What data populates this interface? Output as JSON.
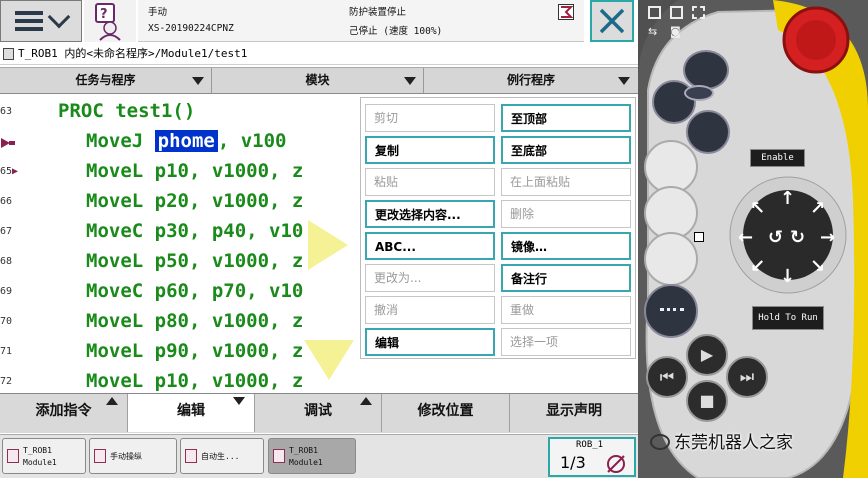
{
  "status": {
    "mode": "手动",
    "controller_name": "XS-20190224CPNZ",
    "safety_status": "防护装置停止",
    "run_status": "己停止 (速度 100%)"
  },
  "breadcrumb": "T_ROB1 内的<未命名程序>/Module1/test1",
  "header": {
    "tasks": "任务与程序",
    "modules": "模块",
    "routines": "例行程序"
  },
  "code_lines": [
    {
      "num": "63",
      "indent": 1,
      "text": "PROC test1()",
      "highlight": ""
    },
    {
      "num": "",
      "indent": 2,
      "pre": "MoveJ ",
      "highlight": "phome",
      "post": ", v100"
    },
    {
      "num": "65",
      "indent": 2,
      "text": "MoveL p10, v1000, z",
      "highlight": ""
    },
    {
      "num": "66",
      "indent": 2,
      "text": "MoveL p20, v1000, z",
      "highlight": ""
    },
    {
      "num": "67",
      "indent": 2,
      "text": "MoveC p30, p40, v10",
      "highlight": ""
    },
    {
      "num": "68",
      "indent": 2,
      "text": "MoveL p50, v1000, z",
      "highlight": ""
    },
    {
      "num": "69",
      "indent": 2,
      "text": "MoveC p60, p70, v10",
      "highlight": ""
    },
    {
      "num": "70",
      "indent": 2,
      "text": "MoveL p80, v1000, z",
      "highlight": ""
    },
    {
      "num": "71",
      "indent": 2,
      "text": "MoveL p90, v1000, z",
      "highlight": ""
    },
    {
      "num": "72",
      "indent": 2,
      "text": "MoveL p10, v1000, z",
      "highlight": ""
    }
  ],
  "edit_menu": {
    "cut": "剪切",
    "to_top": "至顶部",
    "copy": "复制",
    "to_bottom": "至底部",
    "paste": "粘贴",
    "paste_above": "在上面粘贴",
    "change_selection": "更改选择内容...",
    "delete": "删除",
    "abc": "ABC...",
    "mirror": "镜像…",
    "change_to": "更改为...",
    "comment": "备注行",
    "undo": "撤消",
    "redo": "重做",
    "edit": "编辑",
    "select_one": "选择一项"
  },
  "bottom_tabs": {
    "add_instruction": "添加指令",
    "edit": "编辑",
    "debug": "调试",
    "modify_position": "修改位置",
    "show_declaration": "显示声明"
  },
  "taskbar": {
    "task1_line1": "T_ROB1",
    "task1_line2": "Module1",
    "task2": "手动操纵",
    "task3": "自动生...",
    "task4_line1": "T_ROB1",
    "task4_line2": "Module1",
    "rob_label": "ROB_1",
    "rob_fraction": "1/3"
  },
  "pendant": {
    "enable_label": "Enable",
    "hold_label": "Hold To Run"
  },
  "watermark": "东莞机器人之家",
  "colors": {
    "code_green": "#1a8a1a",
    "highlight_blue": "#0033cc",
    "accent_teal": "#2aa8a8",
    "stop_red": "#d42020",
    "pendant_yellow": "#f0d000"
  }
}
